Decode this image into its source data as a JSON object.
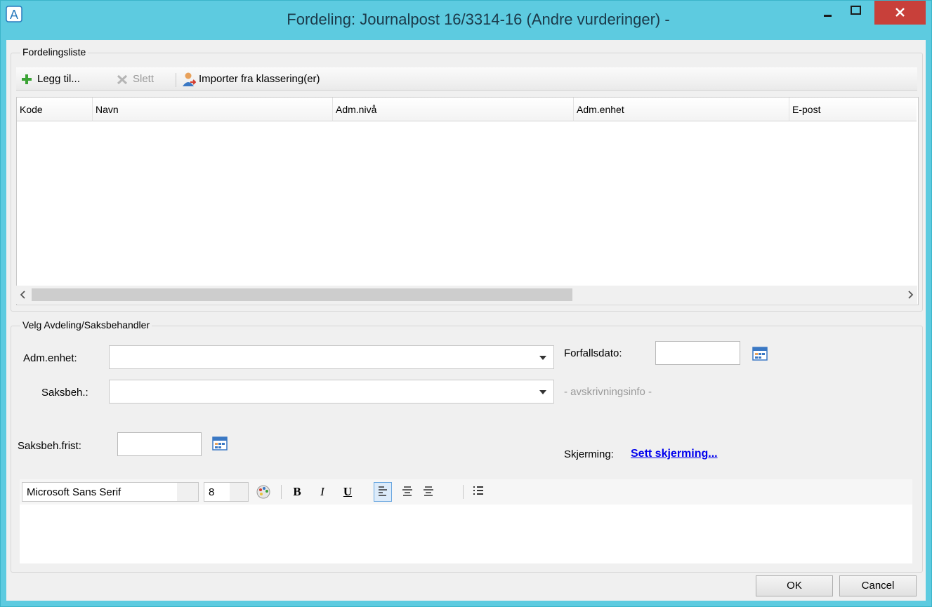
{
  "window": {
    "title": "Fordeling: Journalpost 16/3314-16 (Andre vurderinger) -",
    "app_icon": "A",
    "controls": {
      "minimize": "minimize-icon",
      "maximize": "maximize-icon",
      "close": "close-icon"
    }
  },
  "distribution": {
    "legend": "Fordelingsliste",
    "toolbar": {
      "add_label": "Legg til...",
      "delete_label": "Slett",
      "import_label": "Importer fra klassering(er)"
    },
    "columns": [
      "Kode",
      "Navn",
      "Adm.nivå",
      "Adm.enhet",
      "E-post"
    ],
    "rows": []
  },
  "select": {
    "legend": "Velg Avdeling/Saksbehandler",
    "adm_unit_label": "Adm.enhet:",
    "adm_unit_value": "",
    "case_handler_label": "Saksbeh.:",
    "case_handler_value": "",
    "due_date_label": "Forfallsdato:",
    "due_date_value": "",
    "writeoff_info": "- avskrivningsinfo -",
    "case_deadline_label": "Saksbeh.frist:",
    "case_deadline_value": "",
    "shielding_label": "Skjerming:",
    "shielding_link": "Sett skjerming..."
  },
  "editor": {
    "font_name": "Microsoft Sans Serif",
    "font_size": "8",
    "bold": "B",
    "italic": "I",
    "underline": "U",
    "text": ""
  },
  "buttons": {
    "ok": "OK",
    "cancel": "Cancel"
  },
  "colors": {
    "titlebar": "#5dcbe0",
    "close": "#c8403a",
    "link": "#0000ee"
  }
}
